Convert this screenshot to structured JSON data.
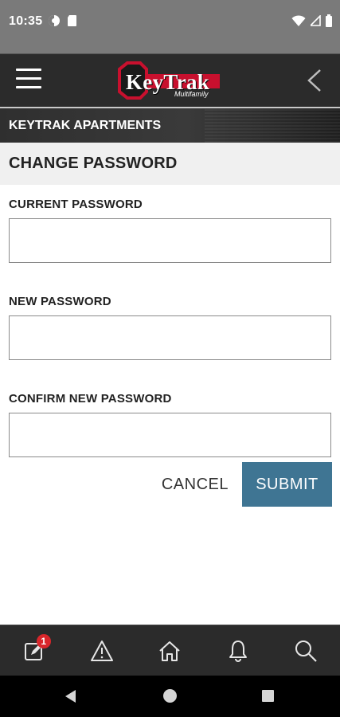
{
  "status_bar": {
    "time": "10:35",
    "left_icons": [
      "data-saver-icon",
      "sim-card-icon"
    ],
    "right_icons": [
      "wifi-icon",
      "signal-icon",
      "battery-icon"
    ]
  },
  "header": {
    "logo_text": "KeyTrak",
    "logo_subtext": "Multifamily",
    "menu_icon": "hamburger-menu-icon",
    "back_icon": "chevron-left-icon"
  },
  "property": {
    "name": "KEYTRAK APARTMENTS"
  },
  "page": {
    "title": "CHANGE PASSWORD"
  },
  "form": {
    "current_password": {
      "label": "CURRENT PASSWORD",
      "value": "",
      "placeholder": ""
    },
    "new_password": {
      "label": "NEW PASSWORD",
      "value": "",
      "placeholder": ""
    },
    "confirm_password": {
      "label": "CONFIRM NEW PASSWORD",
      "value": "",
      "placeholder": ""
    }
  },
  "actions": {
    "cancel_label": "CANCEL",
    "submit_label": "SUBMIT"
  },
  "colors": {
    "accent": "#3f7593",
    "header_bg": "#2b2b2b",
    "badge": "#d9262b",
    "logo_red": "#c8102e"
  },
  "bottom_nav": {
    "items": [
      {
        "icon": "notes-edit-icon",
        "badge": "1"
      },
      {
        "icon": "warning-icon"
      },
      {
        "icon": "home-icon"
      },
      {
        "icon": "bell-icon"
      },
      {
        "icon": "search-icon"
      }
    ]
  },
  "android_nav": {
    "icons": [
      "back-triangle-icon",
      "home-circle-icon",
      "recents-square-icon"
    ]
  }
}
